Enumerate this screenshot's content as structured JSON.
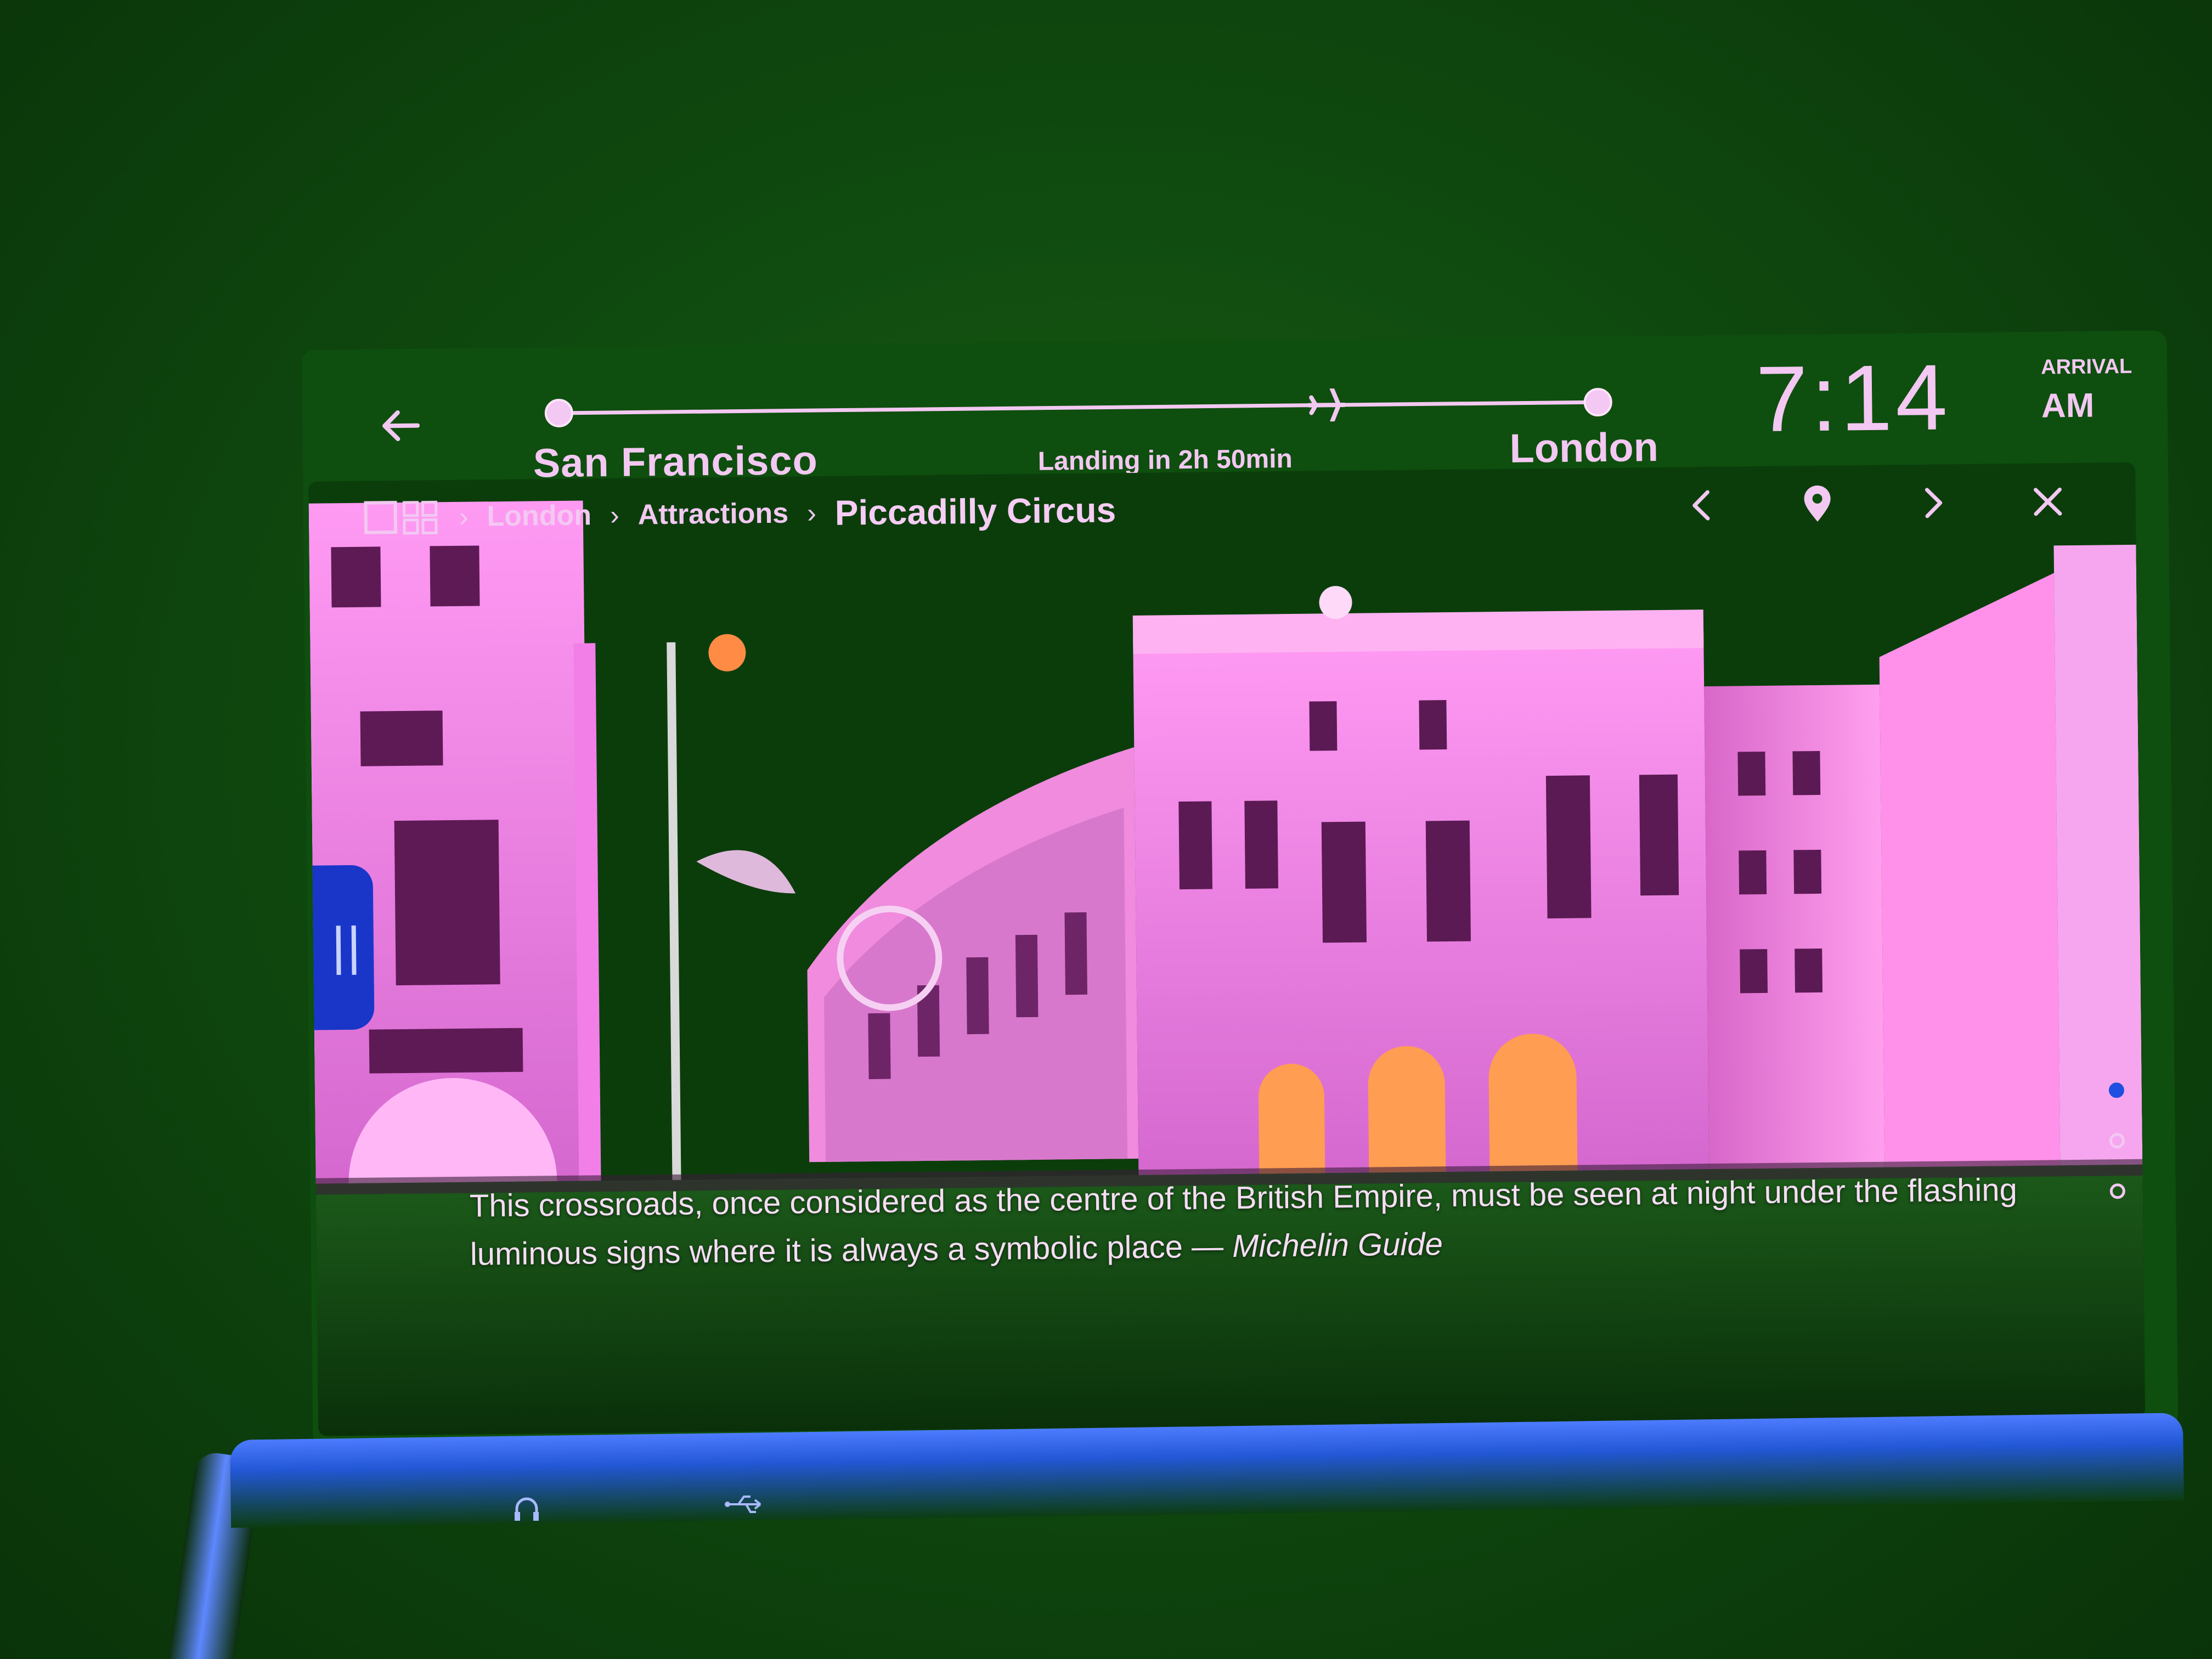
{
  "flight": {
    "origin": "San Francisco",
    "destination": "London",
    "landing_text": "Landing in 2h 50min",
    "progress_fraction": 0.74
  },
  "arrival": {
    "time": "7:14",
    "caption": "ARRIVAL",
    "ampm": "AM"
  },
  "breadcrumb": {
    "items": [
      "London",
      "Attractions"
    ],
    "current": "Piccadilly Circus",
    "separator": "›"
  },
  "caption": {
    "text": "This crossroads, once considered as the centre of the British Empire, must be seen at night under the flashing luminous signs where it is always a symbolic place — ",
    "source": "Michelin Guide"
  },
  "pagination": {
    "count": 3,
    "active_index": 0
  },
  "icons": {
    "back": "arrow-left-icon",
    "gallery": "gallery-grid-icon",
    "previous": "chevron-left-icon",
    "location": "map-pin-icon",
    "next": "chevron-right-icon",
    "close": "close-icon",
    "pause": "pause-icon",
    "headphone": "headphone-jack-icon",
    "usb": "usb-port-icon",
    "plane": "airplane-icon"
  },
  "colors": {
    "accent_text": "#f3c8f2",
    "pause_tab": "#1936c9",
    "active_dot": "#1e4fe0",
    "background": "#0e4e0e"
  }
}
